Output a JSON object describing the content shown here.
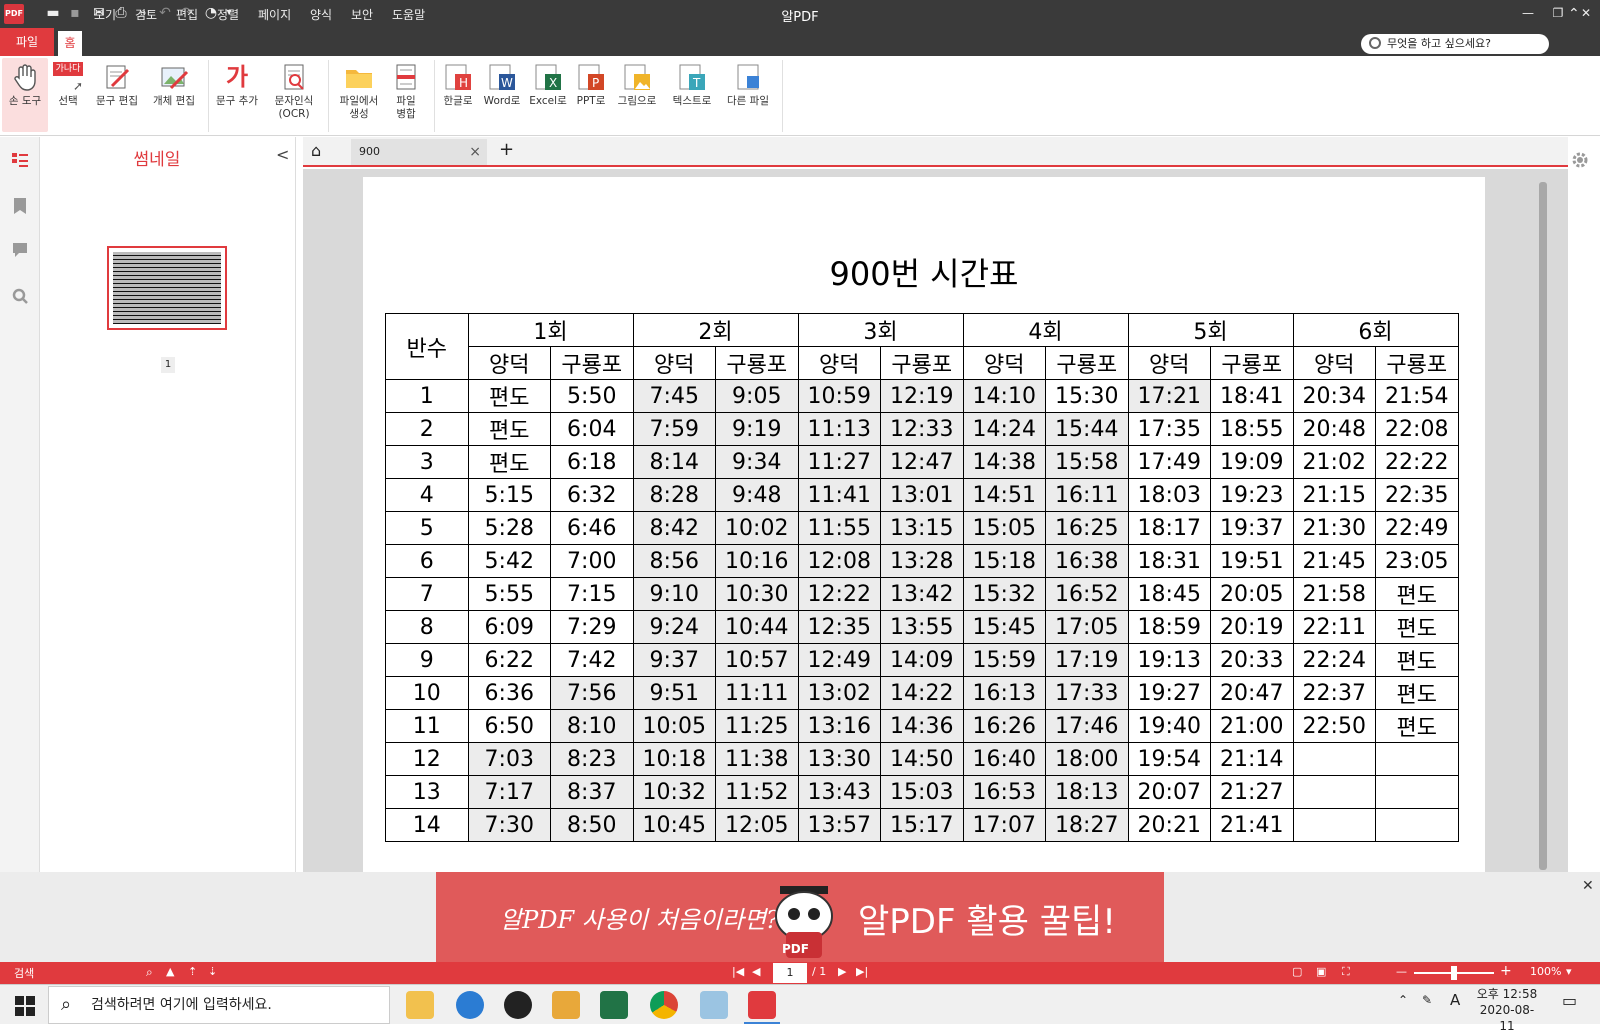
{
  "app": {
    "title": "알PDF",
    "icon_text": "PDF"
  },
  "menu": {
    "file": "파일",
    "home": "홈",
    "items": [
      "보기",
      "검토",
      "편집",
      "정렬",
      "페이지",
      "양식",
      "보안",
      "도움말"
    ],
    "search_placeholder": "무엇을 하고 싶으세요?"
  },
  "ribbon": {
    "hand": "손 도구",
    "select": "선택",
    "select_badge": "가나다",
    "edit_text": "문구 편집",
    "edit_object": "개체 편집",
    "add_text": "문구 추가",
    "add_text_glyph": "가",
    "ocr_l1": "문자인식",
    "ocr_l2": "(OCR)",
    "create_l1": "파일에서",
    "create_l2": "생성",
    "merge_l1": "파일",
    "merge_l2": "병합",
    "to_hangul": "한글로",
    "to_word": "Word로",
    "to_excel": "Excel로",
    "to_ppt": "PPT로",
    "to_image": "그림으로",
    "to_text": "텍스트로",
    "other": "다른 파일"
  },
  "sidebar": {
    "title": "썸네일",
    "page_number": "1"
  },
  "tabs": {
    "doc": "900"
  },
  "document": {
    "title": "900번 시간표",
    "header_label": "반수",
    "rounds": [
      "1회",
      "2회",
      "3회",
      "4회",
      "5회",
      "6회"
    ],
    "stops": [
      "양덕",
      "구룡포"
    ],
    "rows": [
      [
        "1",
        "편도",
        "5:50",
        "7:45",
        "9:05",
        "10:59",
        "12:19",
        "14:10",
        "15:30",
        "17:21",
        "18:41",
        "20:34",
        "21:54"
      ],
      [
        "2",
        "편도",
        "6:04",
        "7:59",
        "9:19",
        "11:13",
        "12:33",
        "14:24",
        "15:44",
        "17:35",
        "18:55",
        "20:48",
        "22:08"
      ],
      [
        "3",
        "편도",
        "6:18",
        "8:14",
        "9:34",
        "11:27",
        "12:47",
        "14:38",
        "15:58",
        "17:49",
        "19:09",
        "21:02",
        "22:22"
      ],
      [
        "4",
        "5:15",
        "6:32",
        "8:28",
        "9:48",
        "11:41",
        "13:01",
        "14:51",
        "16:11",
        "18:03",
        "19:23",
        "21:15",
        "22:35"
      ],
      [
        "5",
        "5:28",
        "6:46",
        "8:42",
        "10:02",
        "11:55",
        "13:15",
        "15:05",
        "16:25",
        "18:17",
        "19:37",
        "21:30",
        "22:49"
      ],
      [
        "6",
        "5:42",
        "7:00",
        "8:56",
        "10:16",
        "12:08",
        "13:28",
        "15:18",
        "16:38",
        "18:31",
        "19:51",
        "21:45",
        "23:05"
      ],
      [
        "7",
        "5:55",
        "7:15",
        "9:10",
        "10:30",
        "12:22",
        "13:42",
        "15:32",
        "16:52",
        "18:45",
        "20:05",
        "21:58",
        "편도"
      ],
      [
        "8",
        "6:09",
        "7:29",
        "9:24",
        "10:44",
        "12:35",
        "13:55",
        "15:45",
        "17:05",
        "18:59",
        "20:19",
        "22:11",
        "편도"
      ],
      [
        "9",
        "6:22",
        "7:42",
        "9:37",
        "10:57",
        "12:49",
        "14:09",
        "15:59",
        "17:19",
        "19:13",
        "20:33",
        "22:24",
        "편도"
      ],
      [
        "10",
        "6:36",
        "7:56",
        "9:51",
        "11:11",
        "13:02",
        "14:22",
        "16:13",
        "17:33",
        "19:27",
        "20:47",
        "22:37",
        "편도"
      ],
      [
        "11",
        "6:50",
        "8:10",
        "10:05",
        "11:25",
        "13:16",
        "14:36",
        "16:26",
        "17:46",
        "19:40",
        "21:00",
        "22:50",
        "편도"
      ],
      [
        "12",
        "7:03",
        "8:23",
        "10:18",
        "11:38",
        "13:30",
        "14:50",
        "16:40",
        "18:00",
        "19:54",
        "21:14",
        "",
        ""
      ],
      [
        "13",
        "7:17",
        "8:37",
        "10:32",
        "11:52",
        "13:43",
        "15:03",
        "16:53",
        "18:13",
        "20:07",
        "21:27",
        "",
        ""
      ],
      [
        "14",
        "7:30",
        "8:50",
        "10:45",
        "12:05",
        "13:57",
        "15:17",
        "17:07",
        "18:27",
        "20:21",
        "21:41",
        "",
        ""
      ]
    ],
    "shaded": [
      [
        0,
        0,
        0,
        1,
        1,
        1,
        1,
        1,
        0,
        1,
        0,
        0,
        0
      ],
      [
        0,
        0,
        0,
        1,
        1,
        1,
        1,
        1,
        1,
        0,
        0,
        0,
        0
      ],
      [
        0,
        0,
        0,
        1,
        1,
        1,
        1,
        1,
        1,
        0,
        0,
        0,
        0
      ],
      [
        0,
        0,
        0,
        1,
        1,
        1,
        1,
        1,
        1,
        0,
        0,
        0,
        0
      ],
      [
        0,
        0,
        0,
        1,
        1,
        1,
        1,
        1,
        1,
        0,
        0,
        0,
        0
      ],
      [
        0,
        0,
        0,
        1,
        1,
        1,
        1,
        1,
        1,
        0,
        0,
        0,
        0
      ],
      [
        0,
        0,
        0,
        1,
        1,
        1,
        1,
        1,
        1,
        0,
        0,
        0,
        0
      ],
      [
        0,
        0,
        0,
        1,
        1,
        1,
        1,
        1,
        1,
        0,
        0,
        0,
        0
      ],
      [
        0,
        0,
        0,
        1,
        1,
        1,
        1,
        1,
        1,
        0,
        0,
        0,
        0
      ],
      [
        0,
        0,
        1,
        1,
        1,
        1,
        1,
        1,
        1,
        0,
        0,
        0,
        0
      ],
      [
        0,
        0,
        1,
        1,
        1,
        1,
        1,
        1,
        1,
        0,
        0,
        0,
        0
      ],
      [
        0,
        1,
        1,
        1,
        1,
        1,
        1,
        1,
        1,
        0,
        0,
        0,
        0
      ],
      [
        0,
        1,
        1,
        1,
        1,
        1,
        1,
        1,
        1,
        0,
        0,
        0,
        0
      ],
      [
        0,
        1,
        1,
        1,
        1,
        1,
        1,
        1,
        1,
        0,
        0,
        0,
        0
      ]
    ]
  },
  "banner": {
    "left_text": "알PDF 사용이 처음이라면?",
    "right_text": "알PDF 활용 꿀팁!",
    "mascot_label": "PDF"
  },
  "status": {
    "search_label": "검색",
    "page_current": "1",
    "page_total": "/ 1",
    "zoom": "100%"
  },
  "taskbar": {
    "search_placeholder": "검색하려면 여기에 입력하세요.",
    "time": "오후 12:58",
    "date": "2020-08-11",
    "ime": "A"
  },
  "colors": {
    "accent": "#e03a3e",
    "titlebar": "#3a3a3a",
    "banner": "#e05a5a"
  }
}
